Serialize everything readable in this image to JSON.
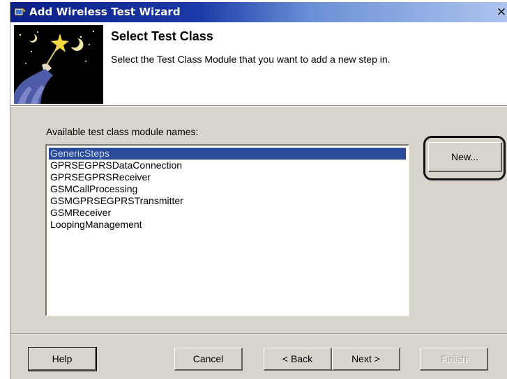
{
  "window": {
    "title": "Add Wireless Test Wizard",
    "close_glyph": "×"
  },
  "header": {
    "title": "Select Test Class",
    "subtitle": "Select the Test Class Module that you want to add a new step in."
  },
  "main": {
    "list_label": "Available test class module names:",
    "items": [
      {
        "label": "GenericSteps",
        "selected": true
      },
      {
        "label": "GPRSEGPRSDataConnection",
        "selected": false
      },
      {
        "label": "GPRSEGPRSReceiver",
        "selected": false
      },
      {
        "label": "GSMCallProcessing",
        "selected": false
      },
      {
        "label": "GSMGPRSEGPRSTransmitter",
        "selected": false
      },
      {
        "label": "GSMReceiver",
        "selected": false
      },
      {
        "label": "LoopingManagement",
        "selected": false
      }
    ],
    "new_button": "New..."
  },
  "footer": {
    "help": "Help",
    "cancel": "Cancel",
    "back": "< Back",
    "next": "Next >",
    "finish": "Finish"
  },
  "icons": {
    "app": "wizard-app-icon",
    "close": "close-icon",
    "wizard_image": "wizard-wand-illustration"
  },
  "colors": {
    "selection": "#2a4b97",
    "title_bar_start": "#0a1f86",
    "title_bar_end": "#aec4ef",
    "dialog_face": "#d8d4cc"
  }
}
